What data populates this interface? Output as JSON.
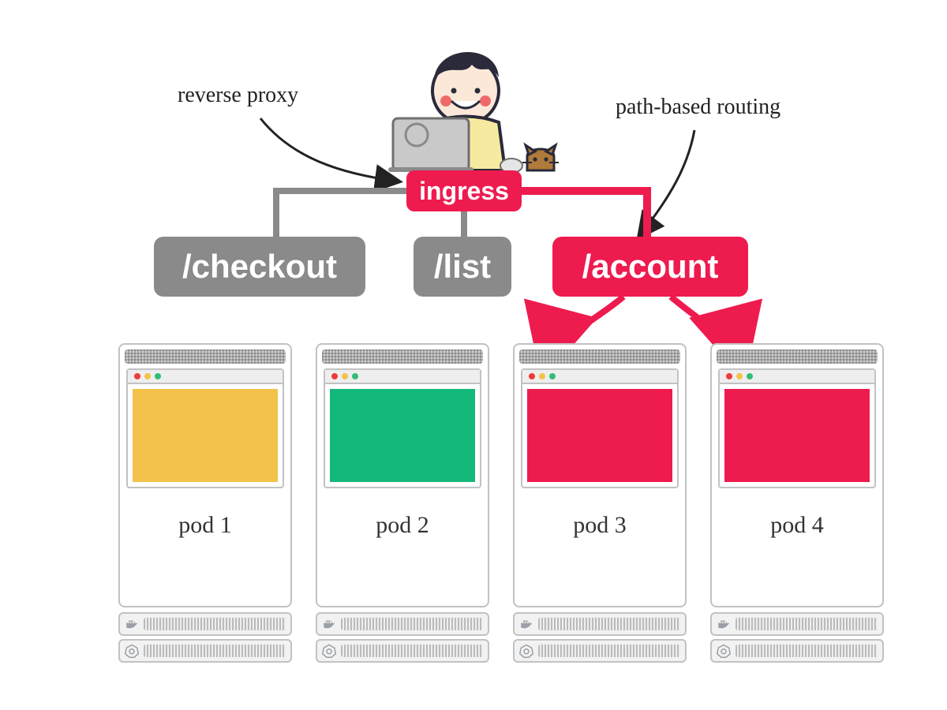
{
  "annotations": {
    "reverse_proxy": "reverse proxy",
    "path_routing": "path-based routing"
  },
  "ingress": {
    "label": "ingress"
  },
  "routes": [
    {
      "path": "/checkout",
      "active": false
    },
    {
      "path": "/list",
      "active": false
    },
    {
      "path": "/account",
      "active": true
    }
  ],
  "pods": [
    {
      "label": "pod 1",
      "color": "#f2c24a"
    },
    {
      "label": "pod 2",
      "color": "#14b87a"
    },
    {
      "label": "pod 3",
      "color": "#ee1b4f"
    },
    {
      "label": "pod 4",
      "color": "#ee1b4f"
    }
  ],
  "colors": {
    "accent": "#ee1b4f",
    "gray": "#8a8a8a",
    "stroke": "#c2c2c2"
  }
}
